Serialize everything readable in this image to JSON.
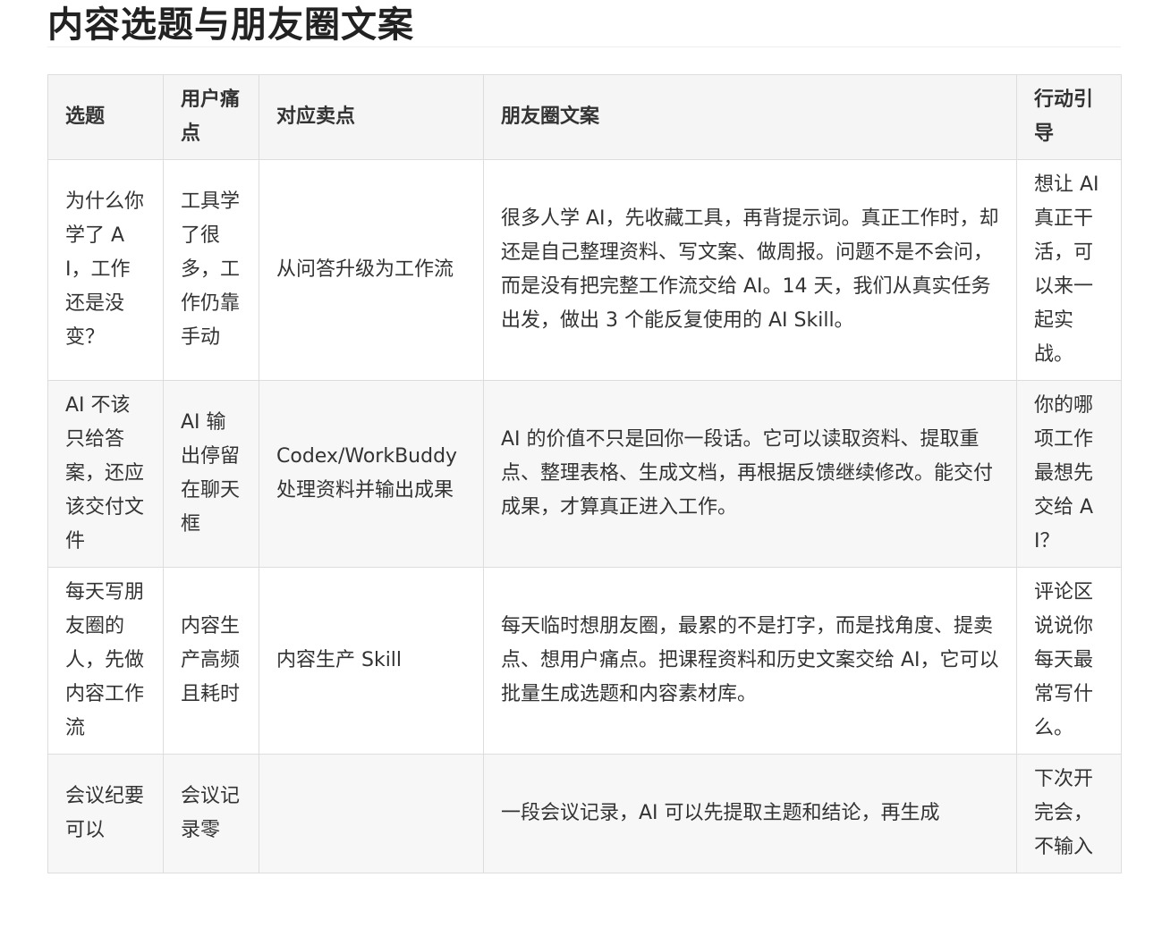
{
  "page": {
    "title": "内容选题与朋友圈文案"
  },
  "table": {
    "headers": [
      "选题",
      "用户痛点",
      "对应卖点",
      "朋友圈文案",
      "行动引导"
    ],
    "rows": [
      [
        "为什么你学了 AI，工作还是没变？",
        "工具学了很多，工作仍靠手动",
        "从问答升级为工作流",
        "很多人学 AI，先收藏工具，再背提示词。真正工作时，却还是自己整理资料、写文案、做周报。问题不是不会问，而是没有把完整工作流交给 AI。14 天，我们从真实任务出发，做出 3 个能反复使用的 AI Skill。",
        "想让 AI 真正干活，可以来一起实战。"
      ],
      [
        "AI 不该只给答案，还应该交付文件",
        "AI 输出停留在聊天框",
        "Codex/WorkBuddy 处理资料并输出成果",
        "AI 的价值不只是回你一段话。它可以读取资料、提取重点、整理表格、生成文档，再根据反馈继续修改。能交付成果，才算真正进入工作。",
        "你的哪项工作最想先交给 AI？"
      ],
      [
        "每天写朋友圈的人，先做内容工作流",
        "内容生产高频且耗时",
        "内容生产 Skill",
        "每天临时想朋友圈，最累的不是打字，而是找角度、提卖点、想用户痛点。把课程资料和历史文案交给 AI，它可以批量生成选题和内容素材库。",
        "评论区说说你每天最常写什么。"
      ],
      [
        "会议纪要可以",
        "会议记录零",
        "",
        "一段会议记录，AI 可以先提取主题和结论，再生成",
        "下次开完会，不输入"
      ]
    ]
  }
}
